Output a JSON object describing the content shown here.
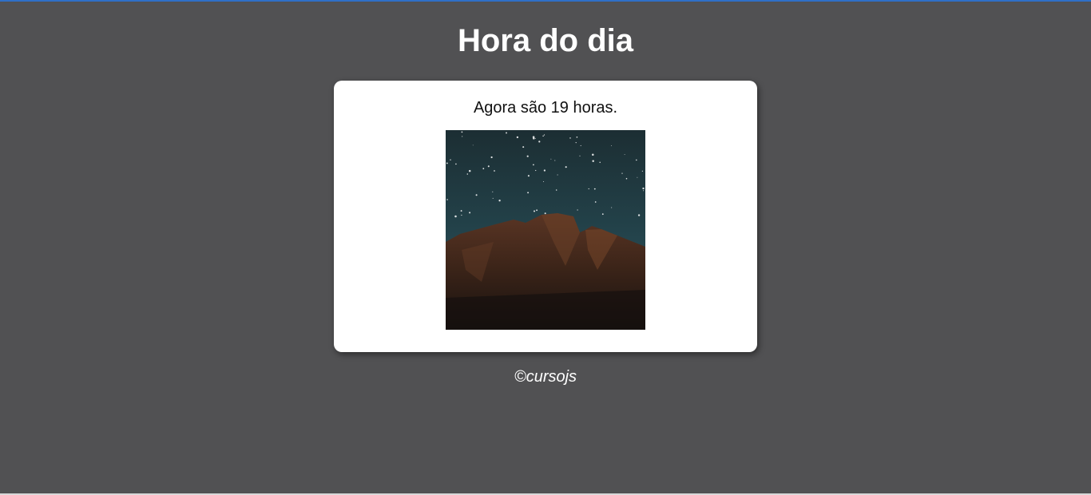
{
  "header": {
    "title": "Hora do dia"
  },
  "main": {
    "message": "Agora são 19 horas.",
    "image": {
      "alt": "night-mountain-starry-sky"
    }
  },
  "footer": {
    "text": "©cursojs"
  },
  "colors": {
    "background": "#515153",
    "card": "#ffffff",
    "top_accent": "#2f6fc7"
  }
}
